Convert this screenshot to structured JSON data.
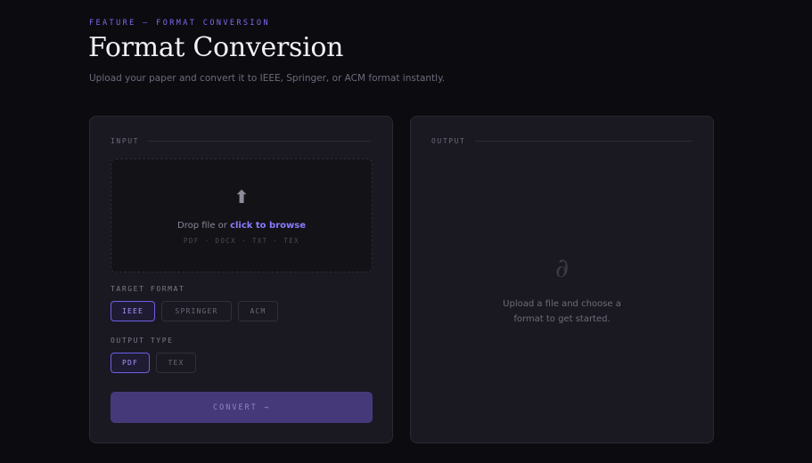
{
  "header": {
    "eyebrow": "FEATURE — FORMAT CONVERSION",
    "title": "Format Conversion",
    "subtitle": "Upload your paper and convert it to IEEE, Springer, or ACM format instantly."
  },
  "input_panel": {
    "label": "INPUT",
    "dropzone": {
      "icon": "upload-arrow-icon",
      "prefix": "Drop file or ",
      "browse": "click to browse",
      "formats": "PDF · DOCX · TXT · TEX"
    },
    "target_format": {
      "label": "TARGET FORMAT",
      "options": [
        "IEEE",
        "SPRINGER",
        "ACM"
      ],
      "selected": "IEEE"
    },
    "output_type": {
      "label": "OUTPUT TYPE",
      "options": [
        "PDF",
        "TEX"
      ],
      "selected": "PDF"
    },
    "convert_label": "CONVERT →"
  },
  "output_panel": {
    "label": "OUTPUT",
    "empty_icon": "∂",
    "empty_text": "Upload a file and choose a format to get started."
  },
  "colors": {
    "background": "#0c0b10",
    "panel": "#1a1921",
    "accent": "#7c6cf0",
    "button": "#46397a"
  }
}
